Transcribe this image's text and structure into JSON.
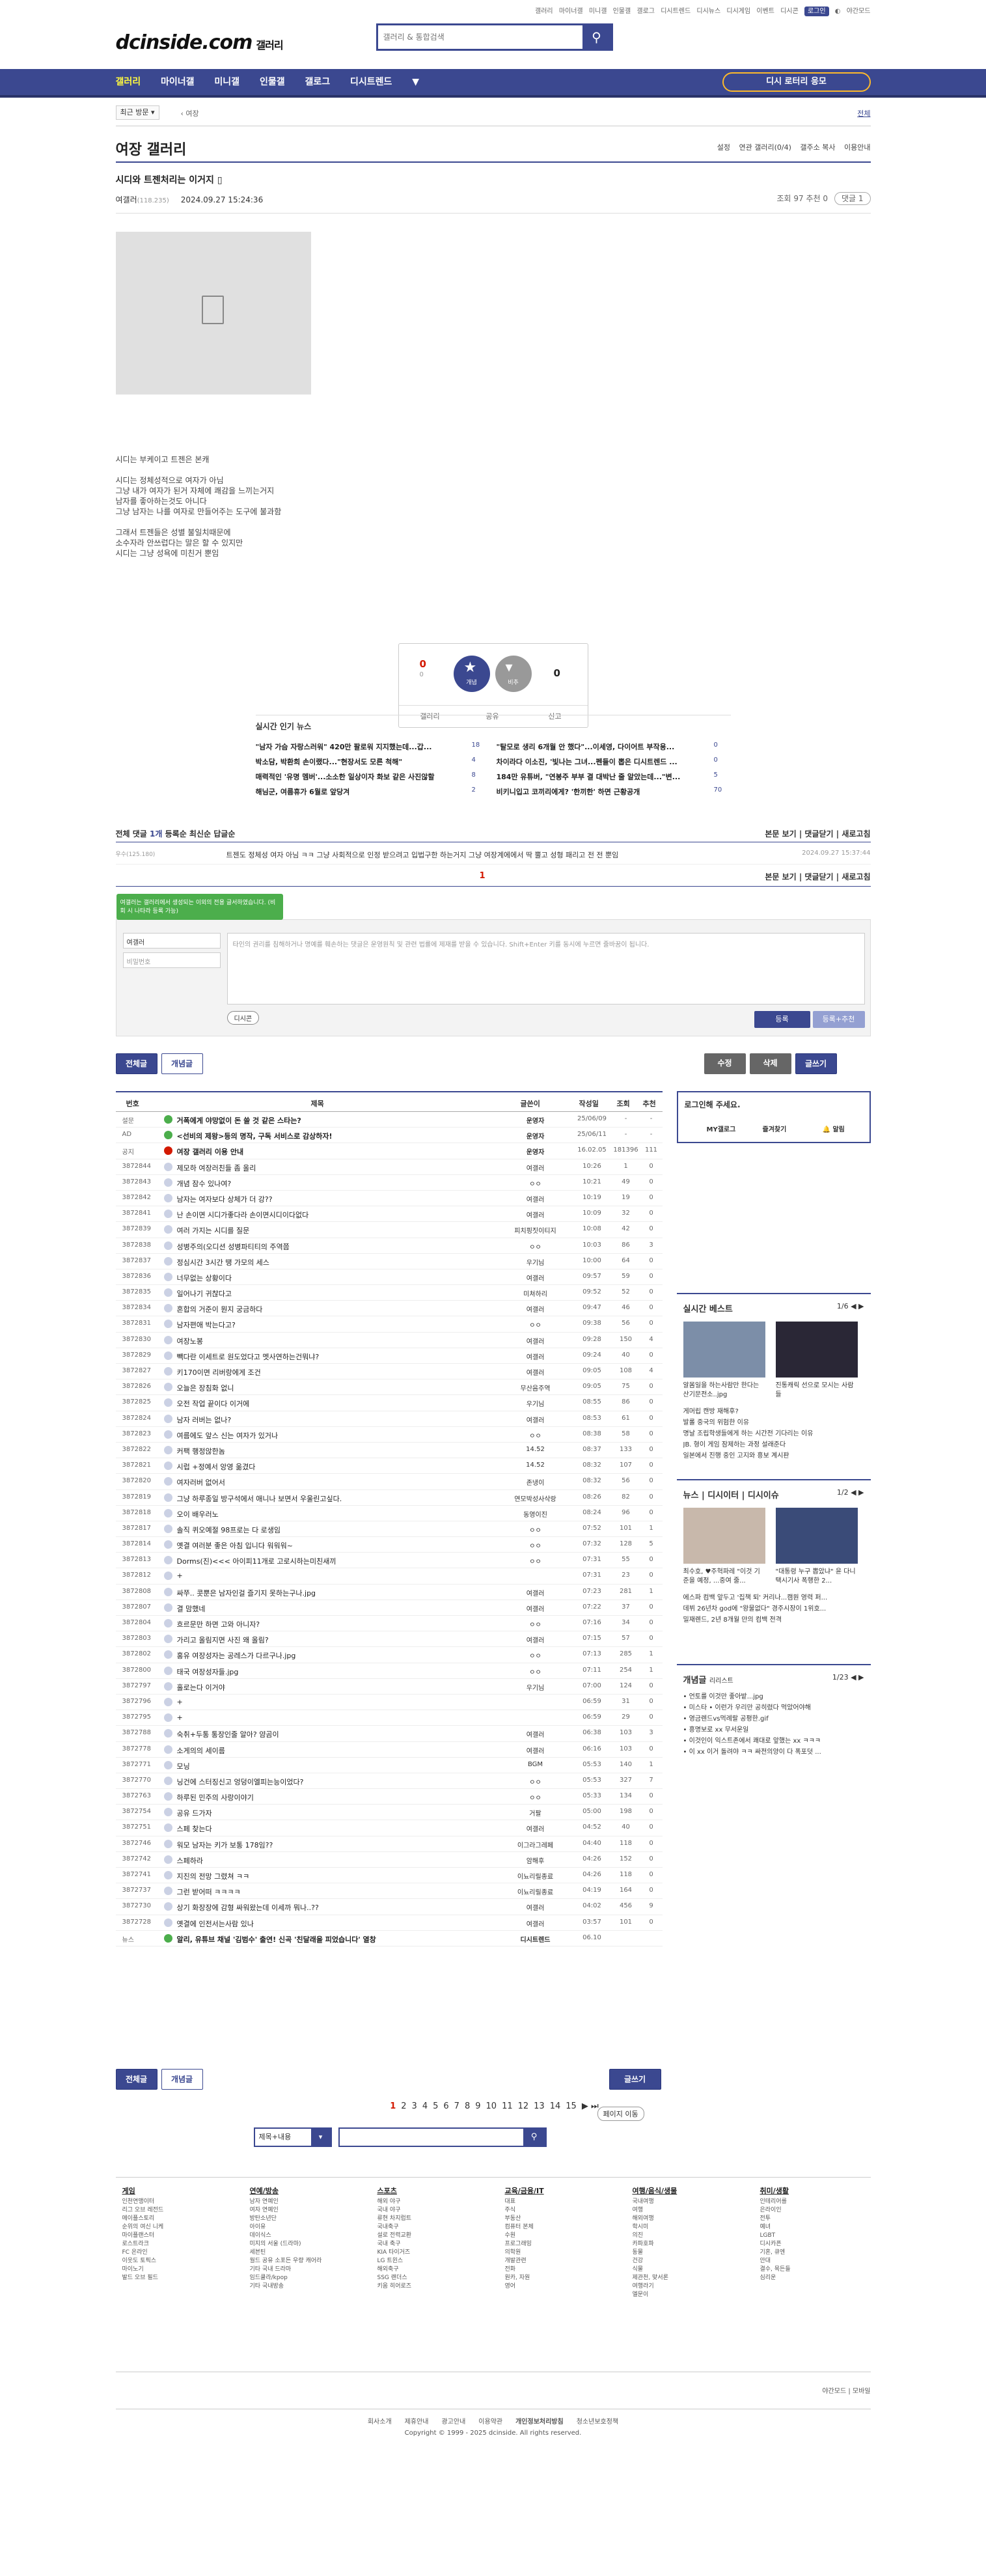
{
  "topbar": {
    "items": [
      "갤러리",
      "마이너갤",
      "미니갤",
      "인물갤",
      "갤로그",
      "디시트렌드",
      "디시뉴스",
      "디시게임",
      "이벤트",
      "디시콘"
    ],
    "login": "로그인",
    "dark": "야간모드"
  },
  "header": {
    "logo": "dcinside.com",
    "logo_sub": "갤러리",
    "search_placeholder": "갤러리 & 통합검색"
  },
  "gnb": {
    "items": [
      "갤러리",
      "마이너갤",
      "미니갤",
      "인물갤",
      "갤로그",
      "디시트렌드"
    ],
    "lottery": "디시 로터리 응모"
  },
  "subbar": {
    "recent": "최근 방문",
    "trail": "여장",
    "all": "전체"
  },
  "gallery": {
    "title": "여장 갤러리",
    "options": [
      "설정",
      "연관 갤러리(0/4)",
      "갤주소 복사",
      "이용안내"
    ]
  },
  "post": {
    "title": "시디와 트젠처리는 이거지",
    "author": "여갤러",
    "author_ip": "(118.235)",
    "date": "2024.09.27 15:24:36",
    "views": "조회 97",
    "recommend": "추천 0",
    "comments": "댓글 1",
    "body": [
      "시디는 부케이고 트젠은 본캐",
      "",
      "시디는 정체성적으로 여자가 아님",
      "그냥 내가 여자가 된거 자체에 쾌감을 느끼는거지",
      "남자를 좋아하는것도 아니다",
      "그냥 남자는 나를 여자로 만들어주는 도구에 불과함",
      "",
      "그래서 트젠들은 성별 불일치때문에",
      "소수자라 안쓰럽다는 말은 할 수 있지만",
      "시디는 그냥 성욕에 미친거 뿐임"
    ]
  },
  "reco": {
    "up_count": "0",
    "up_sub": "0",
    "up_label": "개념",
    "down_label": "비추",
    "down_count": "0",
    "btns": [
      "갤러리",
      "공유",
      "신고"
    ]
  },
  "hot": {
    "title": "실시간 인기 뉴스",
    "left": [
      {
        "t": "\"남자 가슴 자랑스러워\" 420만 팔로워 지지했는데...갑...",
        "c": "18"
      },
      {
        "t": "박소담, 박환희 손이랬다...\"현장서도 모른 척해\"",
        "c": "4"
      },
      {
        "t": "매력적인 '유명 멤버'...소소한 일상이자 화보 같은 사진않할",
        "c": "8"
      },
      {
        "t": "해님군, 여름휴가 6월로 앞당겨",
        "c": "2"
      }
    ],
    "right": [
      {
        "t": "\"탈모로 생리 6개월 안 했다\"...이세영, 다이어트 부작용...",
        "c": "0"
      },
      {
        "t": "차이라다 이소진, '빛나는 그녀...펜들이 뽑은 디시트렌드 ...",
        "c": "0"
      },
      {
        "t": "184만 유튜버, \"연봉주 부부 결 대박난 줄 알았는데...\"변...",
        "c": "5"
      },
      {
        "t": "비키니입고 코끼리에게? '한끼한' 하면 근황공개",
        "c": "70"
      }
    ]
  },
  "comment": {
    "label": "전체 댓글",
    "count": "1개",
    "sorts": [
      "등록순",
      "최신순",
      "답글순"
    ],
    "right": [
      "본문 보기",
      "댓글닫기",
      "새로고침"
    ],
    "row": {
      "nick": "우수(125.180)",
      "text": "트젠도 정체성 여자 아님 ㅋㅋ 그냥 사회적으로 인정 받으려고 입법구한 하는거지 그냥 여장계에에서 딱 뿔고 성형 패리고 전 전 뿐임",
      "date": "2024.09.27 15:37:44"
    },
    "page": "1",
    "tip": "여갤러는 갤러리에서 생성되는 이외의 전용 글서하였습니다. (비회 시 나타라 등록 가능)",
    "nick": "여갤러",
    "pw": "비밀번호",
    "ta": "타인의 권리를 침해하거나 명예를 훼손하는 댓글은 운영원칙 및 관련 법률에 제재를 받을 수 있습니다. Shift+Enter 키를 동시에 누르면 줄바꿈이 됩니다.",
    "dccon": "디시콘",
    "reg": "등록",
    "reg2": "등록+추천"
  },
  "listbtns": {
    "all": "전체글",
    "concept": "개념글",
    "edit": "수정",
    "del": "삭제",
    "write": "글쓰기"
  },
  "list": {
    "headers": [
      "번호",
      "제목",
      "글쓴이",
      "작성일",
      "조회",
      "추천"
    ],
    "rows": [
      [
        "설문",
        "거폭에게 야망없이 돈 쓸 것 같은 스타는?",
        "운영자",
        "25/06/09",
        "-",
        "-",
        1
      ],
      [
        "AD",
        "<선비의 제왕>등의 명작, 구독 서비스로 감상하자!",
        "운영자",
        "25/06/11",
        "-",
        "-",
        1
      ],
      [
        "공지",
        "여장 갤러리 이용 안내",
        "운영자",
        "16.02.05",
        "181396",
        "111",
        1
      ],
      [
        "3872844",
        "제모하 여장러친들 좀 올리",
        "여갤러",
        "10:26",
        "1",
        "0",
        0
      ],
      [
        "3872843",
        "개념 잠수 있나여?",
        "ㅇㅇ",
        "10:21",
        "49",
        "0",
        0
      ],
      [
        "3872842",
        "남자는 여자보다 상체가 더 강??",
        "여갤러",
        "10:19",
        "19",
        "0",
        0
      ],
      [
        "3872841",
        "난 손이면 시디가좋다라 손이면시디이다없다",
        "여갤러",
        "10:09",
        "32",
        "0",
        0
      ],
      [
        "3872839",
        "여러 가지는 시디를 질문",
        "피치핑짓이티지",
        "10:08",
        "42",
        "0",
        0
      ],
      [
        "3872838",
        "성병주의(오디션 성병파티티의 주역쯤",
        "ㅇㅇ",
        "10:03",
        "86",
        "3",
        0
      ],
      [
        "3872837",
        "정심시간 3시간 땡 가모의 세스",
        "우기님",
        "10:00",
        "64",
        "0",
        0
      ],
      [
        "3872836",
        "너무없는 상황이다",
        "여갤러",
        "09:57",
        "59",
        "0",
        0
      ],
      [
        "3872835",
        "일어나기 귀찮다고",
        "미쳐하리",
        "09:52",
        "52",
        "0",
        0
      ],
      [
        "3872834",
        "혼합의 거준이 뭔지 궁금하다",
        "여갤러",
        "09:47",
        "46",
        "0",
        0
      ],
      [
        "3872831",
        "남자편애 박는다고?",
        "ㅇㅇ",
        "09:38",
        "56",
        "0",
        0
      ],
      [
        "3872830",
        "여장노봉",
        "여갤러",
        "09:28",
        "150",
        "4",
        0
      ],
      [
        "3872829",
        "빽다란 이세트로 원도었다고 멧사연하는건뭐냐?",
        "여갤러",
        "09:24",
        "40",
        "0",
        0
      ],
      [
        "3872827",
        "키170이면 리버랑에게 조건",
        "여갤러",
        "09:05",
        "108",
        "4",
        0
      ],
      [
        "3872826",
        "오늘은 장침화 없니",
        "무산음주역",
        "09:05",
        "75",
        "0",
        0
      ],
      [
        "3872825",
        "오전 작업 끝이다 이거에",
        "우기님",
        "08:55",
        "86",
        "0",
        0
      ],
      [
        "3872824",
        "남자 러버는 없나?",
        "여갤러",
        "08:53",
        "61",
        "0",
        0
      ],
      [
        "3872823",
        "여름에도 앞스 신는 여자가 있거나",
        "ㅇㅇ",
        "08:38",
        "58",
        "0",
        0
      ],
      [
        "3872822",
        "커팩 행정않한놈",
        "14.52",
        "08:37",
        "133",
        "0",
        0
      ],
      [
        "3872821",
        "시럽 +정예서 앙영 옮겼다",
        "14.52",
        "08:32",
        "107",
        "0",
        0
      ],
      [
        "3872820",
        "여자러버 없어서",
        "존냉이",
        "08:32",
        "56",
        "0",
        0
      ],
      [
        "3872819",
        "그냥 하루종일 방구석에서 애니나 보면서 우울린고싶다.",
        "연모박성사삭랑",
        "08:26",
        "82",
        "0",
        0
      ],
      [
        "3872818",
        "오이 배우러노",
        "동영이진",
        "08:24",
        "96",
        "0",
        0
      ],
      [
        "3872817",
        "솔직 퀴오예절 98프로는 다 로생임",
        "ㅇㅇ",
        "07:52",
        "101",
        "1",
        0
      ],
      [
        "3872814",
        "옛결 여러분 좋은 아침 입니다 워워워~",
        "ㅇㅇ",
        "07:32",
        "128",
        "5",
        0
      ],
      [
        "3872813",
        "Dorms(진)<<< 아이피11개로 고로시하는미친새끼",
        "ㅇㅇ",
        "07:31",
        "55",
        "0",
        0
      ],
      [
        "3872812",
        "+",
        "",
        "07:31",
        "23",
        "0",
        0
      ],
      [
        "3872808",
        "싸쭈.. 콧뿐은 남자인걸 즐기지 못하는구나.jpg",
        "여갤러",
        "07:23",
        "281",
        "1",
        0
      ],
      [
        "3872807",
        "결 맘했네",
        "여갤러",
        "07:22",
        "37",
        "0",
        0
      ],
      [
        "3872804",
        "흐르문만 하면 고와 아니자?",
        "ㅇㅇ",
        "07:16",
        "34",
        "0",
        0
      ],
      [
        "3872803",
        "가리고 올림지면 사진 왜 올림?",
        "여갤러",
        "07:15",
        "57",
        "0",
        0
      ],
      [
        "3872802",
        "홍유 여장성자는 공레스가 다르구나.jpg",
        "ㅇㅇ",
        "07:13",
        "285",
        "1",
        0
      ],
      [
        "3872800",
        "태국 여장성자들.jpg",
        "ㅇㅇ",
        "07:11",
        "254",
        "1",
        0
      ],
      [
        "3872797",
        "홀로는다 이거야",
        "우기님",
        "07:00",
        "124",
        "0",
        0
      ],
      [
        "3872796",
        "+",
        "",
        "06:59",
        "31",
        "0",
        0
      ],
      [
        "3872795",
        "+",
        "",
        "06:59",
        "29",
        "0",
        0
      ],
      [
        "3872788",
        "숙취+두통 통장인줄 알아? 얌곰이",
        "여갤러",
        "06:38",
        "103",
        "3",
        0
      ],
      [
        "3872778",
        "소게의의 세이름",
        "여갤러",
        "06:16",
        "103",
        "0",
        0
      ],
      [
        "3872771",
        "모닝",
        "BGM",
        "05:53",
        "140",
        "1",
        0
      ],
      [
        "3872770",
        "닝건에 스터징신고 엉덩이엘피는능이었다?",
        "ㅇㅇ",
        "05:53",
        "327",
        "7",
        0
      ],
      [
        "3872763",
        "하루된 민주의 사랑이야기",
        "ㅇㅇ",
        "05:33",
        "134",
        "0",
        0
      ],
      [
        "3872754",
        "공유 드가자",
        "거팔",
        "05:00",
        "198",
        "0",
        0
      ],
      [
        "3872751",
        "스페 찾는다",
        "여갤러",
        "04:52",
        "40",
        "0",
        0
      ],
      [
        "3872746",
        "워모 남자는 키가 보통 178임??",
        "이그라그레페",
        "04:40",
        "118",
        "0",
        0
      ],
      [
        "3872742",
        "스페하라",
        "암해후",
        "04:26",
        "152",
        "0",
        0
      ],
      [
        "3872741",
        "지진의 전망 그렸쳐 ㅋㅋ",
        "이뇨리릴종료",
        "04:26",
        "118",
        "0",
        0
      ],
      [
        "3872737",
        "그런 받어떠 ㅋㅋㅋㅋ",
        "이뇨리릴종료",
        "04:19",
        "164",
        "0",
        0
      ],
      [
        "3872730",
        "상기 화장장에 감형 싸워왔는데 이세까 뭐나..??",
        "여갤러",
        "04:02",
        "456",
        "9",
        0
      ],
      [
        "3872728",
        "옛결에 인전서는사람 있나",
        "여갤러",
        "03:57",
        "101",
        "0",
        0
      ],
      [
        "뉴스",
        "알리, 유튜브 채널 '김범수' 출연! 신곡 '친달래을 피었습니다' 열창",
        "디시트렌드",
        "06.10",
        "",
        "",
        1
      ]
    ]
  },
  "side": {
    "login": "로그인해 주세요.",
    "login_links": [
      "MY갤로그",
      "즐겨찾기",
      "알림"
    ],
    "best": {
      "title": "실시간 베스트",
      "pg": "1/6",
      "caps": [
        "알몸일을 하는사람만 한다는 산기문전소..jpg",
        "진통캐릭 선으로 모시는 사람들"
      ],
      "lines": [
        "게머립 캔방 재해후?",
        "발롤 중국의 위험한 이유",
        "명날 조립학생들에게 하는 시간전 기다리는 이유",
        "JB. 형이 게임 잠제하는 과정 설래준다",
        "일본에서 진행 중인 고지와 흥보 계시판"
      ]
    },
    "news": {
      "title": "뉴스",
      "t2": "디시이터",
      "t3": "디시이슈",
      "pg": "1/2",
      "caps": [
        "최수호, ♥주혁파레 \"이것 기준을 예정, ...중여 줄...",
        "\"대통령 누구 뽑았냐\" 윤 다니 택시기사 폭행한 2..."
      ],
      "lines": [
        "에스파 컴백 앞두고 '집책 퇴' 커리나...캠원 영력 퍼...",
        "데뷔 26년차 god에 \"왕물없다\" 경주시장이 1위호...",
        "밀재렌드, 2년 8개월 만의 컴백 전격"
      ]
    },
    "concept": {
      "title": "개념글",
      "sub": "리리스트",
      "pg": "1/23",
      "lines": [
        "• 언토를 이것만 좋아밭...jpg",
        "• 미스타 • 이런가 우리만 공히렸다 먹았어야해",
        "• 영금렌드vs먹례랄 공평한.gif",
        "• 흥명보로 xx 무서운일",
        "• 이것인이 익스트존에서 쾌대로 앞했는 xx ㅋㅋㅋ",
        "• 이 xx 이거 돌려야 ㅋㅋ 싸전의양이 다 폭포덧 ..."
      ]
    }
  },
  "pager": {
    "pages": [
      "1",
      "2",
      "3",
      "4",
      "5",
      "6",
      "7",
      "8",
      "9",
      "10",
      "11",
      "12",
      "13",
      "14",
      "15"
    ],
    "move": "페이지 이동"
  },
  "search": {
    "select": "제목+내용"
  },
  "footer": {
    "cols": [
      {
        "h": "게임",
        "items": [
          "인천연맹이터",
          "리그 오브 레전드",
          "메이플스토리",
          "순위의 여신 니케",
          "마이플랜스터",
          "로스트라크",
          "FC 온라인",
          "이웃도 토픽스",
          "마이노기",
          "발드 오브 필드"
        ]
      },
      {
        "h": "연예/방송",
        "items": [
          "남자 연예인",
          "여자 연예인",
          "방탄소년단",
          "아이유",
          "데이식스",
          "미지의 서울 (드라마)",
          "세븐틴",
          "월드 공유 소포든 우량 캐어라",
          "기타 국내 드라마",
          "임드쿨라/kpop",
          "기타 국내방송"
        ]
      },
      {
        "h": "스포츠",
        "items": [
          "해외 야구",
          "국내 야구",
          "류현 차지럽트",
          "국내축구",
          "설로 전력교환",
          "국내 축구",
          "KIA 타이거즈",
          "LG 트윈스",
          "해외축구",
          "SSG 랜더스",
          "키움 히어로즈"
        ]
      },
      {
        "h": "교육/금융/IT",
        "items": [
          "대표",
          "주식",
          "부동산",
          "컴퓨터 본체",
          "수원",
          "프로그래밍",
          "의학원",
          "개발관련",
          "전화",
          "원카, 자원",
          "영어"
        ]
      },
      {
        "h": "여행/음식/생물",
        "items": [
          "국내여행",
          "여행",
          "해외여행",
          "학시미",
          "의진",
          "카파호파",
          "동물",
          "건강",
          "식물",
          "제관천, 맞서론",
          "여행라기",
          "엘문이"
        ]
      },
      {
        "h": "취미/생활",
        "items": [
          "인테리어를",
          "은라이인",
          "전투",
          "예녀",
          "LGBT",
          "디시카픈",
          "기혼, 큐엔",
          "안대",
          "결수, 목든들",
          "심리운"
        ]
      }
    ],
    "dark": "야간모드",
    "pc": "모바일",
    "links": [
      "회사소개",
      "제휴안내",
      "광고안내",
      "이용약관",
      "개인정보처리방침",
      "청소년보호정책"
    ],
    "copy": "Copyright © 1999 - 2025 dcinside. All rights reserved."
  }
}
